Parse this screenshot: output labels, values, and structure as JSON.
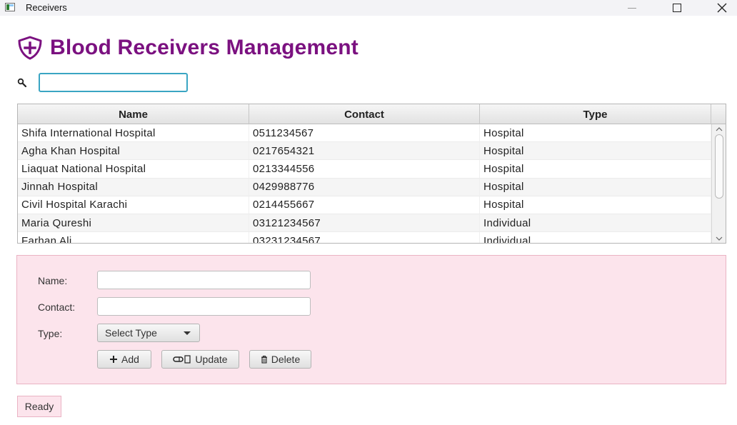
{
  "window": {
    "title": "Receivers"
  },
  "header": {
    "title": "Blood Receivers Management",
    "accent_color": "#7b1180",
    "icon": "shield-plus-icon"
  },
  "search": {
    "value": "",
    "icon": "search-icon"
  },
  "table": {
    "columns": [
      "Name",
      "Contact",
      "Type"
    ],
    "rows": [
      {
        "name": "Shifa International Hospital",
        "contact": "0511234567",
        "type": "Hospital"
      },
      {
        "name": "Agha Khan Hospital",
        "contact": "0217654321",
        "type": "Hospital"
      },
      {
        "name": "Liaquat National Hospital",
        "contact": "0213344556",
        "type": "Hospital"
      },
      {
        "name": "Jinnah Hospital",
        "contact": "0429988776",
        "type": "Hospital"
      },
      {
        "name": "Civil Hospital Karachi",
        "contact": "0214455667",
        "type": "Hospital"
      },
      {
        "name": "Maria Qureshi",
        "contact": "03121234567",
        "type": "Individual"
      },
      {
        "name": "Farhan Ali",
        "contact": "03231234567",
        "type": "Individual"
      }
    ]
  },
  "form": {
    "name_label": "Name:",
    "contact_label": "Contact:",
    "type_label": "Type:",
    "name_value": "",
    "contact_value": "",
    "type_select": "Select Type",
    "panel_color": "#fce4ec",
    "buttons": {
      "add": "Add",
      "update": "Update",
      "delete": "Delete"
    }
  },
  "status": {
    "text": "Ready"
  }
}
